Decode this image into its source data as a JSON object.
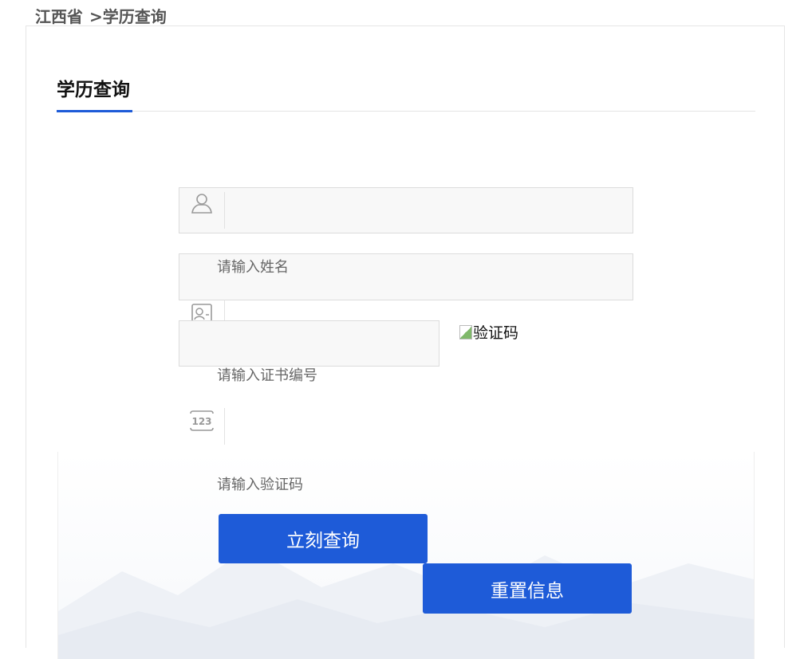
{
  "breadcrumb": {
    "province": "江西省",
    "separator": ">",
    "current": "学历查询"
  },
  "page_title": "学历查询",
  "form": {
    "name": {
      "value": "",
      "placeholder_text": "请输入姓名",
      "icon": "user-icon"
    },
    "certificate": {
      "value": "",
      "placeholder_text": "请输入证书编号",
      "icon": "id-card-icon"
    },
    "captcha": {
      "value": "",
      "placeholder_text": "请输入验证码",
      "icon": "number-123-icon",
      "image_alt": "验证码"
    }
  },
  "buttons": {
    "query": "立刻查询",
    "reset": "重置信息"
  },
  "colors": {
    "accent": "#1e5bd8",
    "field_bg": "#f8f8f8",
    "field_border": "#dcdcdc"
  }
}
